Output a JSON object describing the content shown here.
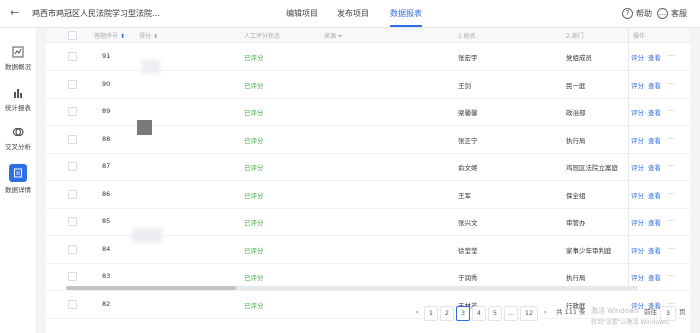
{
  "header": {
    "back_icon": "arrow-left-icon",
    "app_title": "鸡西市鸡冠区人民法院学习型法院...",
    "tabs": [
      "编辑项目",
      "发布项目",
      "数据报表"
    ],
    "active_tab": "数据报表",
    "help_label": "帮助",
    "customer_service_label": "客服",
    "accent_color": "#2f6fe4"
  },
  "sidebar": {
    "items": [
      {
        "label": "数据概况",
        "icon": "line-chart-icon"
      },
      {
        "label": "统计报表",
        "icon": "bar-chart-icon"
      },
      {
        "label": "交叉分析",
        "icon": "cross-analysis-icon"
      },
      {
        "label": "数据详情",
        "icon": "document-icon",
        "active": true
      }
    ]
  },
  "table": {
    "columns": [
      "答题序号",
      "得分",
      "人工评分状态",
      "来源",
      "1.姓名",
      "2.部门",
      "操作"
    ],
    "rows": [
      {
        "id": "91",
        "status": "已评分",
        "name": "张宏宇",
        "dept": "党组成员"
      },
      {
        "id": "90",
        "status": "已评分",
        "name": "王剑",
        "dept": "民一庭"
      },
      {
        "id": "89",
        "status": "已评分",
        "name": "梁馨馨",
        "dept": "政治部"
      },
      {
        "id": "88",
        "status": "已评分",
        "name": "张正宁",
        "dept": "执行局"
      },
      {
        "id": "87",
        "status": "已评分",
        "name": "俞文姬",
        "dept": "鸡冠区法院立案庭"
      },
      {
        "id": "86",
        "status": "已评分",
        "name": "王军",
        "dept": "保全组"
      },
      {
        "id": "85",
        "status": "已评分",
        "name": "张兴文",
        "dept": "审管办"
      },
      {
        "id": "84",
        "status": "已评分",
        "name": "徐莹莹",
        "dept": "家事少年审判庭"
      },
      {
        "id": "83",
        "status": "已评分",
        "name": "于润秀",
        "dept": "执行局"
      },
      {
        "id": "82",
        "status": "已评分",
        "name": "王林英",
        "dept": "行政庭"
      }
    ],
    "op_score": "评分",
    "op_view": "查看",
    "op_more": "···",
    "status_color": "#3cb043"
  },
  "pagination": {
    "prev": "‹",
    "next": "›",
    "pages": [
      "1",
      "2",
      "3",
      "4",
      "5",
      "...",
      "12"
    ],
    "current": "3",
    "total_text": "共 111 条",
    "goto_prefix": "前往",
    "goto_value": "3",
    "goto_suffix": "页"
  },
  "watermark": {
    "line1": "激活 Windows",
    "line2": "转到\"设置\"以激活 Windows。"
  }
}
